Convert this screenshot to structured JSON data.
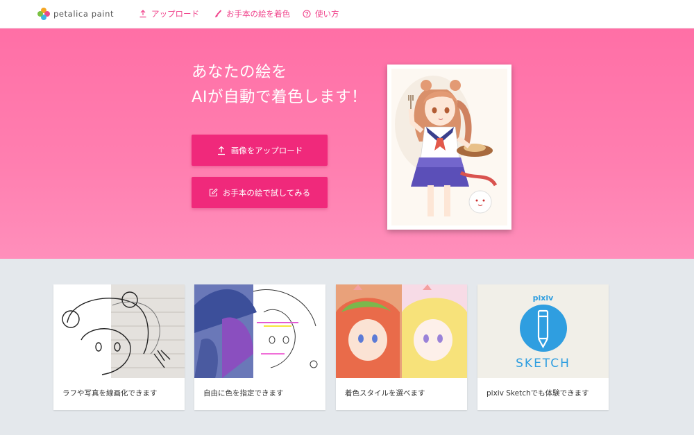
{
  "header": {
    "logo_text": "petalica paint",
    "nav": [
      {
        "label": "アップロード",
        "icon": "upload-icon"
      },
      {
        "label": "お手本の絵を着色",
        "icon": "brush-icon"
      },
      {
        "label": "使い方",
        "icon": "help-icon"
      }
    ]
  },
  "hero": {
    "title_line1": "あなたの絵を",
    "title_line2": "AIが自動で着色します！",
    "upload_button": "画像をアップロード",
    "sample_button": "お手本の絵で試してみる"
  },
  "features": [
    {
      "caption": "ラフや写真を線画化できます"
    },
    {
      "caption": "自由に色を指定できます"
    },
    {
      "caption": "着色スタイルを選べます"
    },
    {
      "caption": "pixiv Sketchでも体験できます"
    }
  ],
  "sketch_card": {
    "brand": "pixiv",
    "product": "SKETCH"
  },
  "colors": {
    "accent": "#f0418a",
    "button": "#f0297b",
    "hero_top": "#ff6fa6",
    "hero_bottom": "#ff8fbb",
    "page_bg": "#e4e8ec",
    "sketch_blue": "#2f9ee0"
  }
}
